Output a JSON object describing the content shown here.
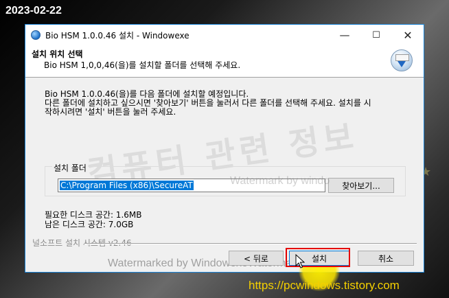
{
  "date_stamp": "2023-02-22",
  "window": {
    "title": "Bio HSM 1.0.0.46 설치    - Windowexe",
    "minimize_glyph": "—",
    "maximize_glyph": "☐",
    "close_glyph": "✕"
  },
  "header": {
    "title": "설치 위치 선택",
    "subtitle": "Bio HSM 1,0,0,46(을)를 설치할 폴더를 선택해 주세요."
  },
  "body": {
    "line1": "Bio HSM 1.0.0.46(을)를 다음 폴더에 설치할 예정입니다.",
    "line2": "다른 폴더에 설치하고 싶으시면 '찾아보기' 버튼을 눌러서 다른 폴더를 선택해 주세요. 설치를 시",
    "line3": "작하시려면 '설치' 버튼을 눌러 주세요."
  },
  "install_folder": {
    "label": "설치 폴더",
    "path": "C:\\Program Files (x86)\\SecureAT",
    "browse_label": "찾아보기..."
  },
  "disk": {
    "required": "필요한 디스크 공간: 1.6MB",
    "available": "남은 디스크 공간: 7.0GB"
  },
  "branding": "널소프트 설치 시스템 v2.46",
  "buttons": {
    "back": "< 뒤로",
    "install": "설치",
    "cancel": "취소"
  },
  "watermarks": {
    "big": "컴퓨터 관련 정보",
    "mid": "Watermark by windo",
    "bottom": "Watermarked by WindowexeWatermark"
  },
  "site_url": "https://pcwindows.tistory.com",
  "colors": {
    "selection": "#0078d7",
    "highlight": "#e40000",
    "spotlight": "#ffe800",
    "site_url": "#f5d000"
  }
}
